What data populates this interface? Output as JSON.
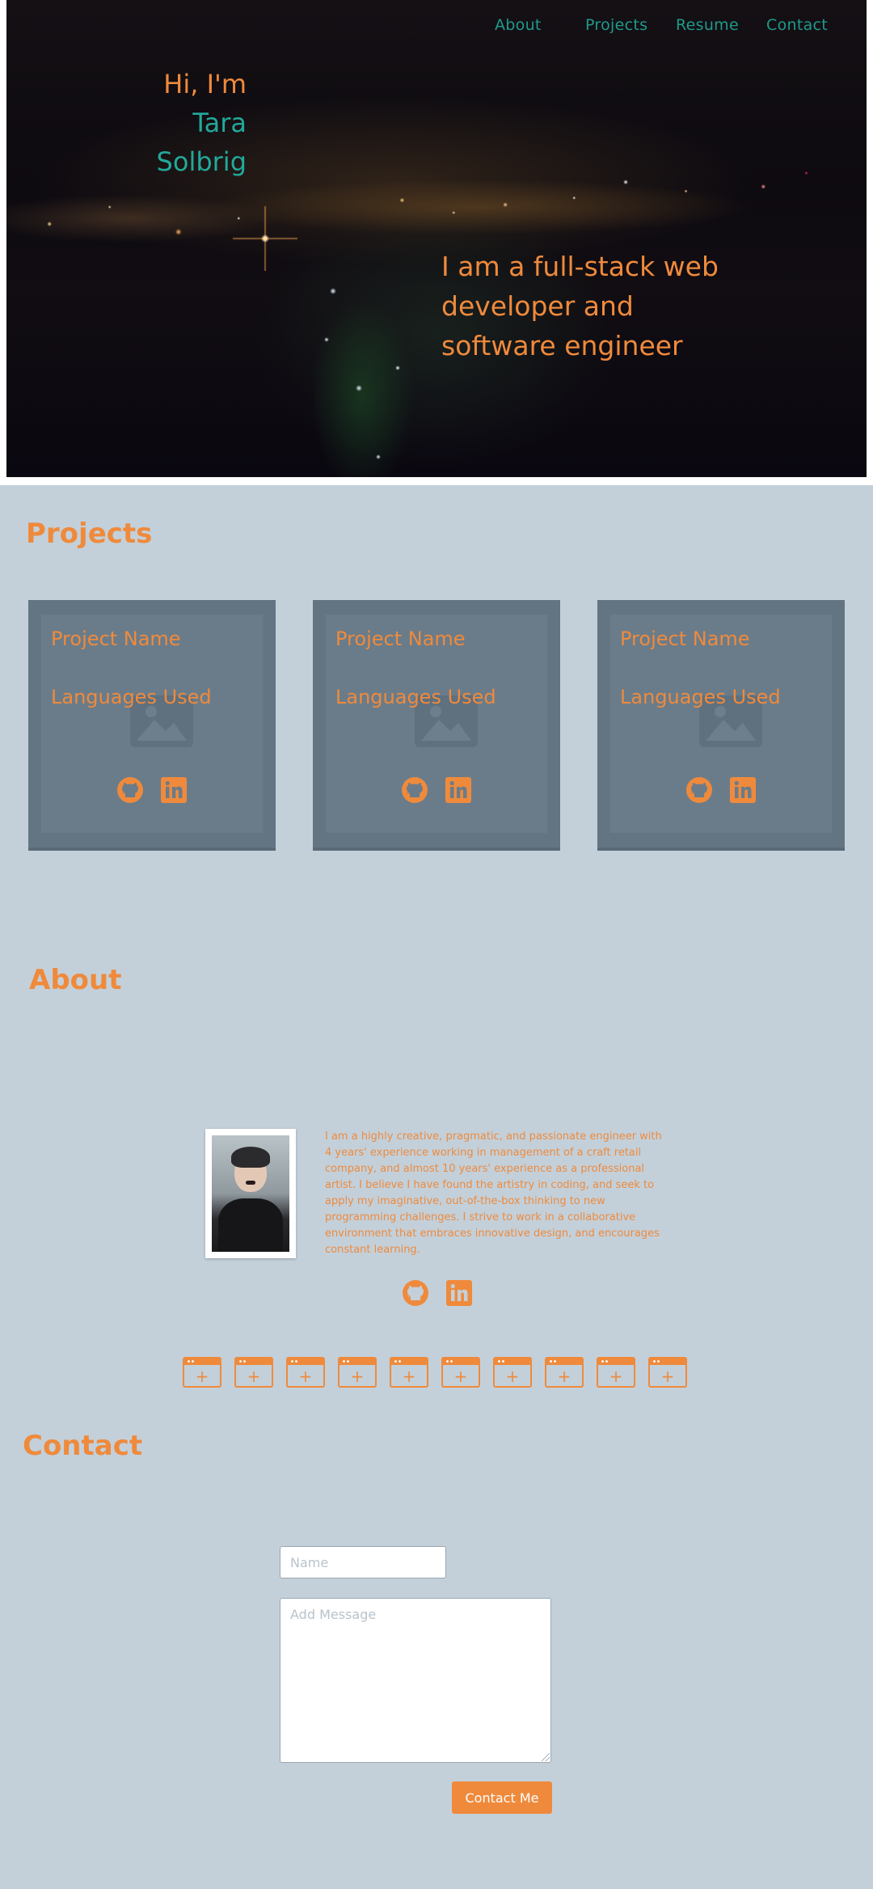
{
  "nav": {
    "about": "About",
    "projects": "Projects",
    "resume": "Resume",
    "contact": "Contact"
  },
  "hero": {
    "greeting": "Hi, I'm",
    "first_name": "Tara",
    "last_name": "Solbrig",
    "tagline": "I am a full-stack web developer and software engineer"
  },
  "projects": {
    "title": "Projects",
    "cards": [
      {
        "name": "Project Name",
        "languages": "Languages Used"
      },
      {
        "name": "Project Name",
        "languages": "Languages Used"
      },
      {
        "name": "Project Name",
        "languages": "Languages Used"
      }
    ]
  },
  "about": {
    "title": "About",
    "bio": "I am a highly creative, pragmatic, and passionate engineer with 4 years' experience working in management of a craft retail company, and almost 10 years' experience as a professional artist. I believe I have found the artistry in coding, and seek to apply my imaginative, out-of-the-box thinking to new programming challenges. I strive to work in a collaborative environment that embraces innovative design, and encourages constant learning.",
    "skills_count": 10
  },
  "contact": {
    "title": "Contact",
    "name_placeholder": "Name",
    "message_placeholder": "Add Message",
    "button_label": "Contact Me"
  },
  "icons": {
    "github": "github-icon",
    "linkedin": "linkedin-icon"
  },
  "colors": {
    "accent": "#ef8a3c",
    "teal": "#22a99a",
    "background": "#c3d0da",
    "card": "#637583"
  }
}
